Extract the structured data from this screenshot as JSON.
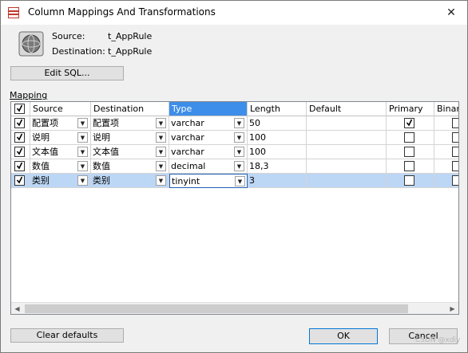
{
  "window": {
    "title": "Column Mappings And Transformations",
    "close_glyph": "✕"
  },
  "info": {
    "source_label": "Source:",
    "source_value": "t_AppRule",
    "destination_label": "Destination:",
    "destination_value": "t_AppRule"
  },
  "toolbar": {
    "edit_sql_label": "Edit SQL..."
  },
  "mapping": {
    "label": "Mapping",
    "columns": [
      "Source",
      "Destination",
      "Type",
      "Length",
      "Default",
      "Primary",
      "Binar"
    ],
    "active_column": "Type",
    "rows": [
      {
        "enabled": true,
        "source": "配置项",
        "destination": "配置项",
        "type": "varchar",
        "length": "50",
        "default": "",
        "primary": true,
        "binary": false,
        "selected": false
      },
      {
        "enabled": true,
        "source": "说明",
        "destination": "说明",
        "type": "varchar",
        "length": "100",
        "default": "",
        "primary": false,
        "binary": false,
        "selected": false
      },
      {
        "enabled": true,
        "source": "文本值",
        "destination": "文本值",
        "type": "varchar",
        "length": "100",
        "default": "",
        "primary": false,
        "binary": false,
        "selected": false
      },
      {
        "enabled": true,
        "source": "数值",
        "destination": "数值",
        "type": "decimal",
        "length": "18,3",
        "default": "",
        "primary": false,
        "binary": false,
        "selected": false
      },
      {
        "enabled": true,
        "source": "类别",
        "destination": "类别",
        "type": "tinyint",
        "length": "3",
        "default": "",
        "primary": false,
        "binary": false,
        "selected": true
      }
    ]
  },
  "footer": {
    "clear_defaults_label": "Clear defaults",
    "ok_label": "OK",
    "cancel_label": "Cancel"
  },
  "watermark": "CSDN @xdiy",
  "colors": {
    "header_active": "#3d8ee9",
    "row_selected": "#bcd6f5",
    "primary_button_border": "#0078d7"
  }
}
